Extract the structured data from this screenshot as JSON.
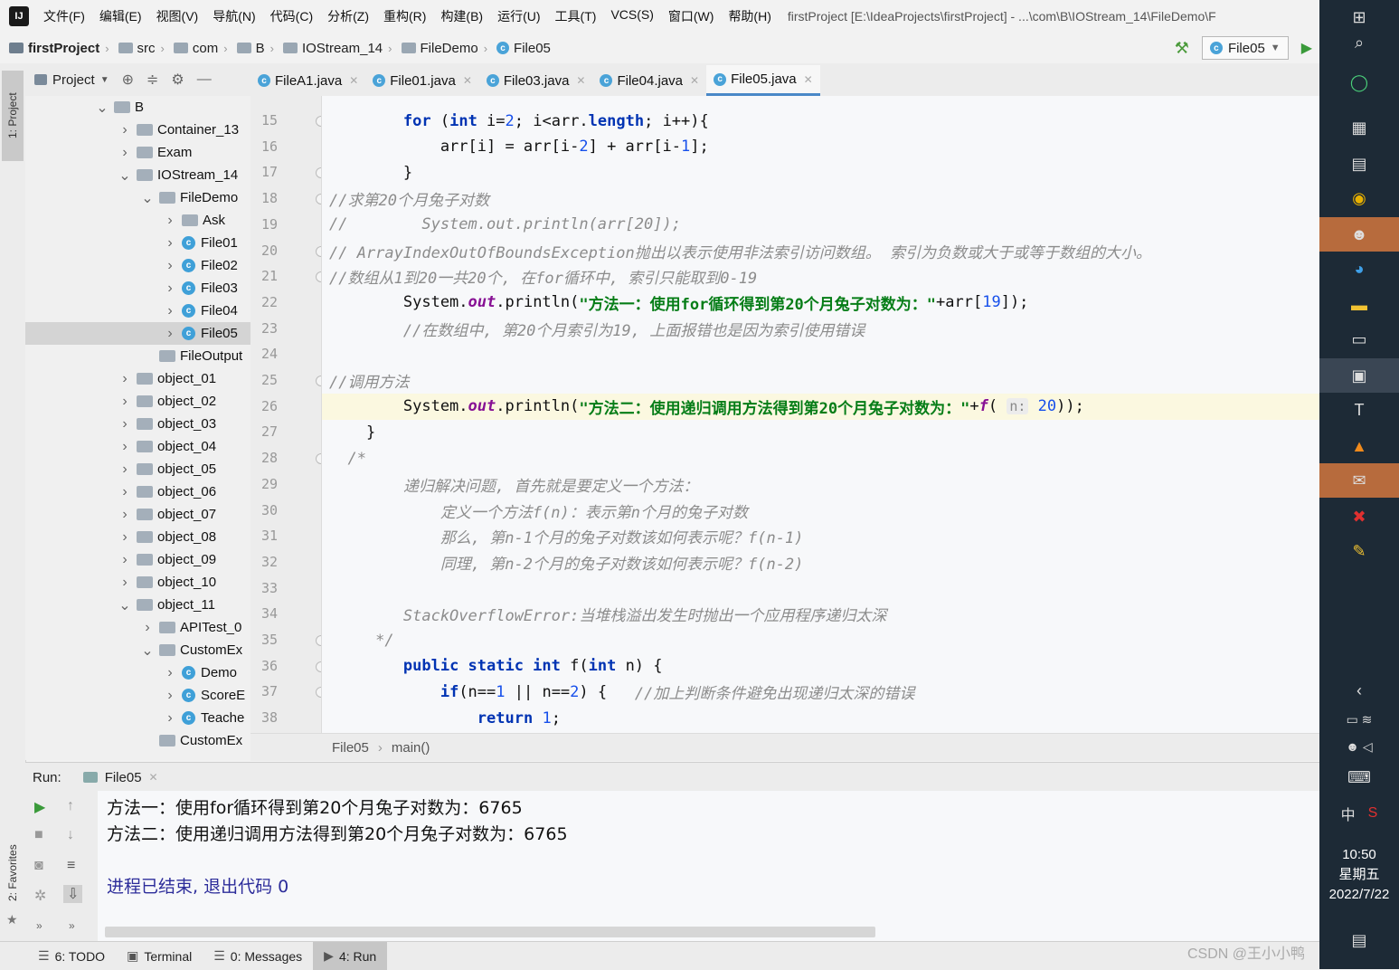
{
  "menu": {
    "items": [
      "文件(F)",
      "编辑(E)",
      "视图(V)",
      "导航(N)",
      "代码(C)",
      "分析(Z)",
      "重构(R)",
      "构建(B)",
      "运行(U)",
      "工具(T)",
      "VCS(S)",
      "窗口(W)",
      "帮助(H)"
    ],
    "window_title": "firstProject [E:\\IdeaProjects\\firstProject] - ...\\com\\B\\IOStream_14\\FileDemo\\F"
  },
  "nav": {
    "crumbs": [
      "firstProject",
      "src",
      "com",
      "B",
      "IOStream_14",
      "FileDemo",
      "File05"
    ],
    "run_config": "File05"
  },
  "left_strip": {
    "project_tab": "1: Project",
    "favorites_tab": "2: Favorites"
  },
  "project_panel": {
    "title": "Project"
  },
  "tree": [
    {
      "label": "B",
      "indent": 4,
      "arrow": "v",
      "icon": "folder"
    },
    {
      "label": "Container_13",
      "indent": 5,
      "arrow": ">",
      "icon": "folder"
    },
    {
      "label": "Exam",
      "indent": 5,
      "arrow": ">",
      "icon": "folder"
    },
    {
      "label": "IOStream_14",
      "indent": 5,
      "arrow": "v",
      "icon": "folder"
    },
    {
      "label": "FileDemo",
      "indent": 6,
      "arrow": "v",
      "icon": "folder"
    },
    {
      "label": "Ask",
      "indent": 7,
      "arrow": ">",
      "icon": "folder"
    },
    {
      "label": "File01",
      "indent": 7,
      "arrow": ">",
      "icon": "class"
    },
    {
      "label": "File02",
      "indent": 7,
      "arrow": ">",
      "icon": "class"
    },
    {
      "label": "File03",
      "indent": 7,
      "arrow": ">",
      "icon": "class"
    },
    {
      "label": "File04",
      "indent": 7,
      "arrow": ">",
      "icon": "class"
    },
    {
      "label": "File05",
      "indent": 7,
      "arrow": ">",
      "icon": "class",
      "selected": true
    },
    {
      "label": "FileOutput",
      "indent": 6,
      "arrow": "",
      "icon": "folder"
    },
    {
      "label": "object_01",
      "indent": 5,
      "arrow": ">",
      "icon": "folder"
    },
    {
      "label": "object_02",
      "indent": 5,
      "arrow": ">",
      "icon": "folder"
    },
    {
      "label": "object_03",
      "indent": 5,
      "arrow": ">",
      "icon": "folder"
    },
    {
      "label": "object_04",
      "indent": 5,
      "arrow": ">",
      "icon": "folder"
    },
    {
      "label": "object_05",
      "indent": 5,
      "arrow": ">",
      "icon": "folder"
    },
    {
      "label": "object_06",
      "indent": 5,
      "arrow": ">",
      "icon": "folder"
    },
    {
      "label": "object_07",
      "indent": 5,
      "arrow": ">",
      "icon": "folder"
    },
    {
      "label": "object_08",
      "indent": 5,
      "arrow": ">",
      "icon": "folder"
    },
    {
      "label": "object_09",
      "indent": 5,
      "arrow": ">",
      "icon": "folder"
    },
    {
      "label": "object_10",
      "indent": 5,
      "arrow": ">",
      "icon": "folder"
    },
    {
      "label": "object_11",
      "indent": 5,
      "arrow": "v",
      "icon": "folder"
    },
    {
      "label": "APITest_0",
      "indent": 6,
      "arrow": ">",
      "icon": "folder"
    },
    {
      "label": "CustomEx",
      "indent": 6,
      "arrow": "v",
      "icon": "folder"
    },
    {
      "label": "Demo",
      "indent": 7,
      "arrow": ">",
      "icon": "class"
    },
    {
      "label": "ScoreE",
      "indent": 7,
      "arrow": ">",
      "icon": "class"
    },
    {
      "label": "Teache",
      "indent": 7,
      "arrow": ">",
      "icon": "class"
    },
    {
      "label": "CustomEx",
      "indent": 6,
      "arrow": "",
      "icon": "folder"
    }
  ],
  "tabs": [
    {
      "label": "FileA1.java"
    },
    {
      "label": "File01.java"
    },
    {
      "label": "File03.java"
    },
    {
      "label": "File04.java"
    },
    {
      "label": "File05.java",
      "active": true
    }
  ],
  "code": {
    "lines": [
      {
        "n": "15",
        "parts": [
          [
            "",
            "        "
          ],
          [
            "kw",
            "for"
          ],
          [
            "",
            " ("
          ],
          [
            "kw",
            "int"
          ],
          [
            "",
            " i="
          ],
          [
            "num",
            "2"
          ],
          [
            "",
            "; i<arr."
          ],
          [
            "kw",
            "length"
          ],
          [
            "",
            "; i++){"
          ]
        ]
      },
      {
        "n": "16",
        "parts": [
          [
            "",
            "            arr[i] = arr[i-"
          ],
          [
            "num",
            "2"
          ],
          [
            "",
            "] + arr[i-"
          ],
          [
            "num",
            "1"
          ],
          [
            "",
            "];"
          ]
        ]
      },
      {
        "n": "17",
        "parts": [
          [
            "",
            "        }"
          ]
        ]
      },
      {
        "n": "18",
        "parts": [
          [
            "cmt",
            "//求第20个月兔子对数"
          ]
        ]
      },
      {
        "n": "19",
        "parts": [
          [
            "cmt",
            "//        System.out.println(arr[20]);"
          ]
        ]
      },
      {
        "n": "20",
        "parts": [
          [
            "cmt",
            "// ArrayIndexOutOfBoundsException抛出以表示使用非法索引访问数组。 索引为负数或大于或等于数组的大小。"
          ]
        ]
      },
      {
        "n": "21",
        "parts": [
          [
            "cmt",
            "//数组从1到20一共20个, 在for循环中, 索引只能取到0-19"
          ]
        ]
      },
      {
        "n": "22",
        "parts": [
          [
            "",
            "        System."
          ],
          [
            "field",
            "out"
          ],
          [
            "",
            ".println("
          ],
          [
            "str",
            "\"方法一：使用for循环得到第20个月兔子对数为：\""
          ],
          [
            "",
            "+arr["
          ],
          [
            "num",
            "19"
          ],
          [
            "",
            "]);"
          ]
        ]
      },
      {
        "n": "23",
        "parts": [
          [
            "",
            "        "
          ],
          [
            "cmt",
            "//在数组中, 第20个月索引为19, 上面报错也是因为索引使用错误"
          ]
        ]
      },
      {
        "n": "24",
        "parts": [
          [
            "",
            ""
          ]
        ]
      },
      {
        "n": "25",
        "parts": [
          [
            "cmt",
            "//调用方法"
          ]
        ]
      },
      {
        "n": "26",
        "cur": true,
        "parts": [
          [
            "",
            "        System."
          ],
          [
            "field",
            "out"
          ],
          [
            "",
            ".println("
          ],
          [
            "str",
            "\"方法二：使用递归调用方法得到第20个月兔子对数为：\""
          ],
          [
            "",
            "+"
          ],
          [
            "field",
            "f"
          ],
          [
            "",
            "( "
          ],
          [
            "hint",
            "n:"
          ],
          [
            "",
            ""
          ],
          [
            "num",
            " 20"
          ],
          [
            "",
            "));"
          ]
        ]
      },
      {
        "n": "27",
        "parts": [
          [
            "",
            "    }"
          ]
        ]
      },
      {
        "n": "28",
        "parts": [
          [
            "cmt",
            "  /*"
          ]
        ]
      },
      {
        "n": "29",
        "parts": [
          [
            "cmt",
            "        递归解决问题, 首先就是要定义一个方法："
          ]
        ]
      },
      {
        "n": "30",
        "parts": [
          [
            "cmt",
            "            定义一个方法f(n)：表示第n个月的兔子对数"
          ]
        ]
      },
      {
        "n": "31",
        "parts": [
          [
            "cmt",
            "            那么, 第n-1个月的兔子对数该如何表示呢？f(n-1)"
          ]
        ]
      },
      {
        "n": "32",
        "parts": [
          [
            "cmt",
            "            同理, 第n-2个月的兔子对数该如何表示呢？f(n-2)"
          ]
        ]
      },
      {
        "n": "33",
        "parts": [
          [
            "",
            ""
          ]
        ]
      },
      {
        "n": "34",
        "parts": [
          [
            "cmt",
            "        StackOverflowError:当堆栈溢出发生时抛出一个应用程序递归太深"
          ]
        ]
      },
      {
        "n": "35",
        "parts": [
          [
            "cmt",
            "     */"
          ]
        ]
      },
      {
        "n": "36",
        "parts": [
          [
            "",
            "        "
          ],
          [
            "kw",
            "public static int"
          ],
          [
            "",
            " f("
          ],
          [
            "kw",
            "int"
          ],
          [
            "",
            " n) {"
          ]
        ]
      },
      {
        "n": "37",
        "parts": [
          [
            "",
            "            "
          ],
          [
            "kw",
            "if"
          ],
          [
            "",
            "(n=="
          ],
          [
            "num",
            "1"
          ],
          [
            "",
            " || n=="
          ],
          [
            "num",
            "2"
          ],
          [
            "",
            ") {   "
          ],
          [
            "cmt",
            "//加上判断条件避免出现递归太深的错误"
          ]
        ]
      },
      {
        "n": "38",
        "parts": [
          [
            "",
            "                "
          ],
          [
            "kw",
            "return"
          ],
          [
            "",
            " "
          ],
          [
            "num",
            "1"
          ],
          [
            "",
            ";"
          ]
        ]
      }
    ],
    "breadcrumb": [
      "File05",
      "main()"
    ]
  },
  "run": {
    "label": "Run:",
    "tab": "File05",
    "output": [
      "方法一：使用for循环得到第20个月兔子对数为：6765",
      "方法二：使用递归调用方法得到第20个月兔子对数为：6765",
      "",
      "进程已结束, 退出代码 0"
    ]
  },
  "status": {
    "items": [
      {
        "label": "6: TODO",
        "icon": "list-icon"
      },
      {
        "label": "Terminal",
        "icon": "terminal-icon"
      },
      {
        "label": "0: Messages",
        "icon": "messages-icon"
      },
      {
        "label": "4: Run",
        "icon": "run-icon",
        "active": true
      }
    ],
    "watermark": "CSDN @王小小鸭"
  },
  "taskbar": {
    "ime": "中",
    "time": "10:50",
    "weekday": "星期五",
    "date": "2022/7/22"
  }
}
